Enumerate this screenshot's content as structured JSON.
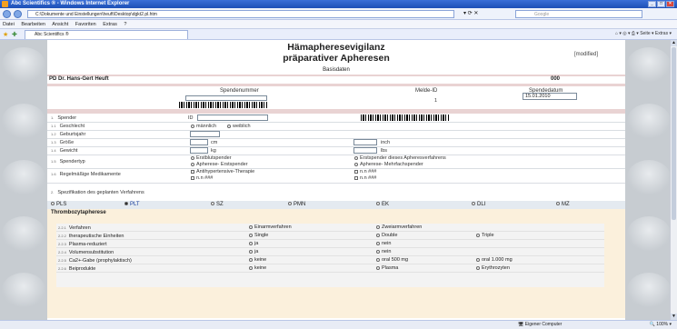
{
  "window": {
    "title": "Abc Scientifics ® - Windows Internet Explorer"
  },
  "address": {
    "url": "C:\\Dokumente und Einstellungen\\heuft\\Desktop\\dgkt2.pl.htm",
    "search_placeholder": "Google"
  },
  "menu": [
    "Datei",
    "Bearbeiten",
    "Ansicht",
    "Favoriten",
    "Extras",
    "?"
  ],
  "tab": {
    "label": "Abc Scientifics ®"
  },
  "toolbar_right": {
    "seite": "Seite",
    "extras": "Extras"
  },
  "form": {
    "title_line1": "Hämapheresevigilanz",
    "title_line2": "präparativer Apheresen",
    "modified": "[modified]",
    "basisdaten": "Basisdaten",
    "doctor": "PD Dr. Hans-Gert Heuft",
    "doctor_id": "000",
    "spendennummer_label": "Spendenummer",
    "melde_id_label": "Melde-ID",
    "melde_id_value": "1",
    "spendedatum_label": "Spendedatum",
    "spendedatum_value": "15.01.2010",
    "rows": [
      {
        "num": "1.",
        "label": "Spender"
      },
      {
        "num": "1.1",
        "label": "Geschlecht"
      },
      {
        "num": "1.2",
        "label": "Geburtsjahr"
      },
      {
        "num": "1.3",
        "label": "Größe"
      },
      {
        "num": "1.4",
        "label": "Gewicht"
      },
      {
        "num": "1.5",
        "label": "Spendertyp"
      },
      {
        "num": "1.6",
        "label": "Regelmäßige Medikamente"
      }
    ],
    "id_prefix": "ID",
    "gender_m": "männlich",
    "gender_w": "weiblich",
    "unit_cm": "cm",
    "unit_inch": "inch",
    "unit_kg": "kg",
    "unit_lbs": "lbs",
    "spendertyp_1": "Erstblutspender",
    "spendertyp_2": "Apherese- Erstspender",
    "spendertyp_3": "Erstspender dieses Apheresverfahrens",
    "spendertyp_4": "Apherese- Mehrfachspender",
    "med_1": "Antihypertensive-Therapie",
    "med_2": "n.n ###",
    "med_3": "n.n ###",
    "med_4": "n.n ###",
    "section2_num": "2.",
    "section2": "Spezifikation des geplanten Verfahrens"
  },
  "procedure_tabs": [
    "PLS",
    "PLT",
    "SZ",
    "PMN",
    "EK",
    "DLI",
    "MZ"
  ],
  "thrombo": {
    "heading": "Thrombozytapherese",
    "rows": [
      {
        "num": "2.2.1",
        "label": "Verfahren",
        "opts": [
          "Einarmverfahren",
          "Zweiarmverfahren"
        ]
      },
      {
        "num": "2.2.2",
        "label": "therapeutische Einheiten",
        "opts": [
          "Single",
          "Double",
          "Triple"
        ]
      },
      {
        "num": "2.2.3",
        "label": "Plasma-reduziert",
        "opts": [
          "ja",
          "nein"
        ]
      },
      {
        "num": "2.2.4",
        "label": "Volumensubstitution",
        "opts": [
          "ja",
          "nein"
        ]
      },
      {
        "num": "2.2.5",
        "label": "Ca2+-Gabe (prophylaktisch)",
        "opts": [
          "keine",
          "oral 500 mg",
          "oral 1.000 mg"
        ]
      },
      {
        "num": "2.2.6",
        "label": "Beiprodukte",
        "opts": [
          "keine",
          "Plasma",
          "Erythrozyten"
        ]
      }
    ]
  },
  "status": {
    "zone": "Eigener Computer",
    "zoom": "100%"
  }
}
